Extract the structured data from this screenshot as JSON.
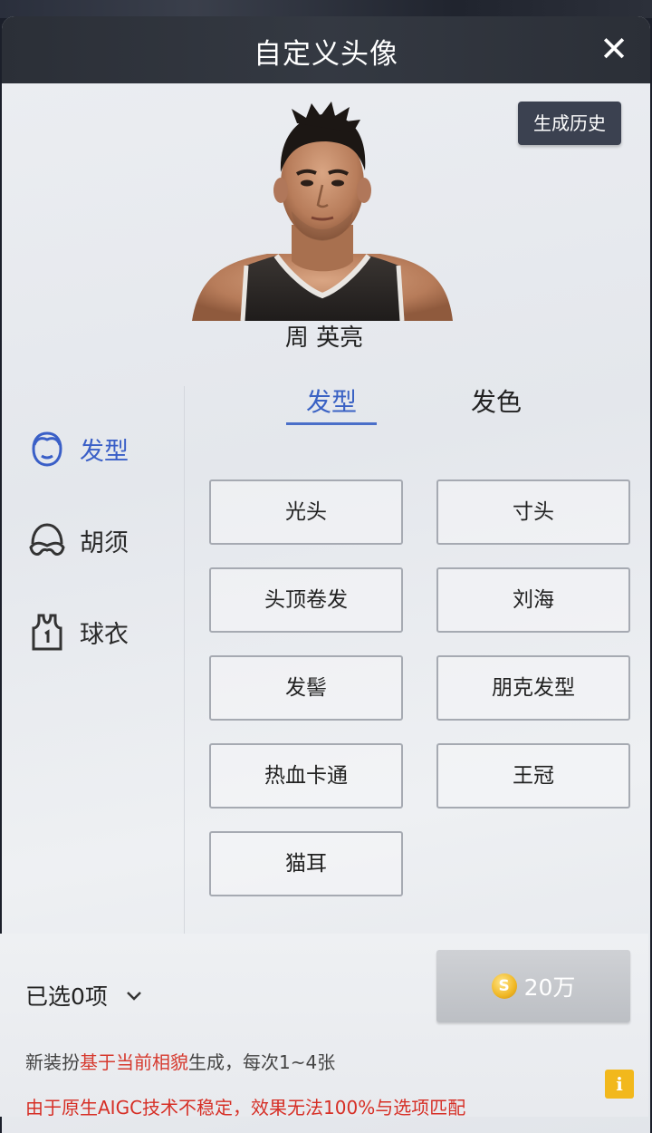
{
  "header": {
    "title": "自定义头像",
    "close_icon": "close-icon"
  },
  "history_button": "生成历史",
  "player": {
    "name": "周 英亮"
  },
  "categories": [
    {
      "label": "发型",
      "icon": "face-hair-icon",
      "active": true
    },
    {
      "label": "胡须",
      "icon": "mustache-icon",
      "active": false
    },
    {
      "label": "球衣",
      "icon": "jersey-icon",
      "active": false
    }
  ],
  "tabs": [
    {
      "label": "发型",
      "active": true
    },
    {
      "label": "发色",
      "active": false
    }
  ],
  "options": [
    "光头",
    "寸头",
    "头顶卷发",
    "刘海",
    "发髻",
    "朋克发型",
    "热血卡通",
    "王冠",
    "猫耳"
  ],
  "footer": {
    "selected": "已选0项",
    "price": "20万",
    "note_prefix": "新装扮",
    "note_highlight": "基于当前相貌",
    "note_suffix": "生成，每次1~4张",
    "warning": "由于原生AIGC技术不稳定，效果无法100%与选项匹配",
    "info_label": "i"
  },
  "colors": {
    "accent": "#3a5fc7",
    "warning": "#d62f26",
    "info": "#f2b81c",
    "titlebar": "#2b2f37"
  }
}
